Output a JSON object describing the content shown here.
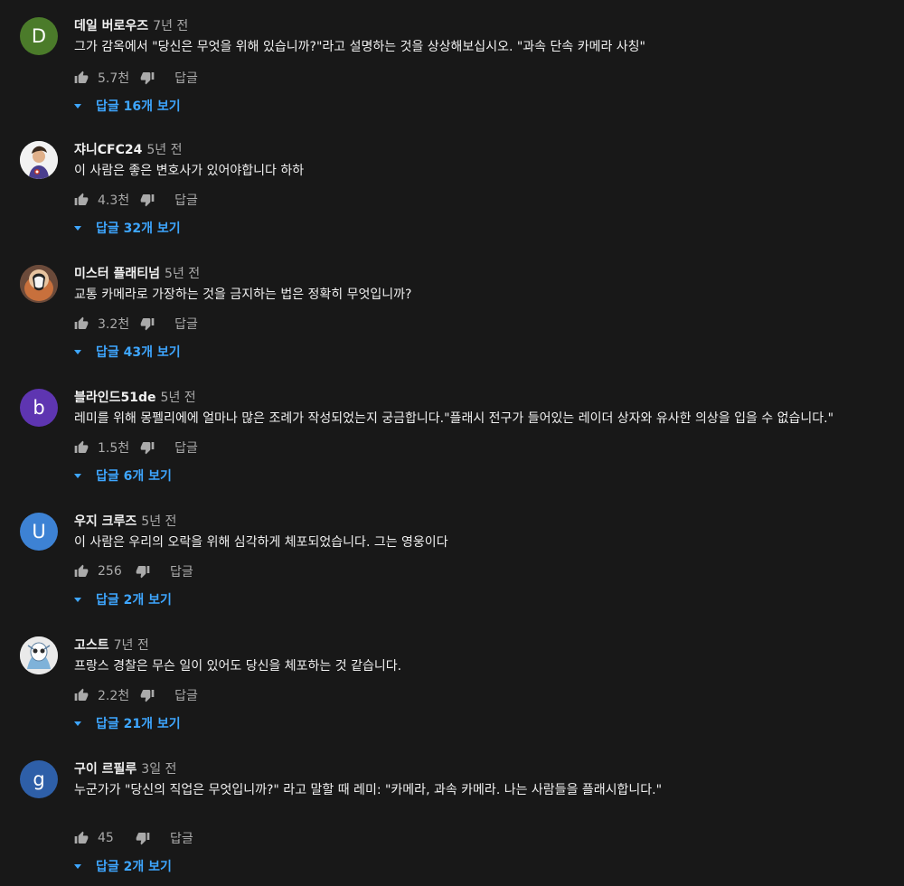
{
  "comments": [
    {
      "author": "데일 버로우즈",
      "time": "7년 전",
      "text": "그가 감옥에서 \"당신은 무엇을 위해 있습니까?\"라고 설명하는 것을 상상해보십시오. \"과속 단속 카메라 사칭\"",
      "likes": "5.7천",
      "reply_label": "답글",
      "replies_label": "답글 16개 보기",
      "avatar_letter": "D",
      "avatar_color": "#4b7b2a"
    },
    {
      "author": "쟈니CFC24",
      "time": "5년 전",
      "text": "이 사람은 좋은 변호사가 있어야합니다 하하",
      "likes": "4.3천",
      "reply_label": "답글",
      "replies_label": "답글 32개 보기",
      "avatar_letter": "",
      "avatar_color": "#f2f2f2"
    },
    {
      "author": "미스터 플래티넘",
      "time": "5년 전",
      "text": "교통 카메라로 가장하는 것을 금지하는 법은 정확히 무엇입니까?",
      "likes": "3.2천",
      "reply_label": "답글",
      "replies_label": "답글 43개 보기",
      "avatar_letter": "",
      "avatar_color": "#8a5a3c"
    },
    {
      "author": "블라인드51de",
      "time": "5년 전",
      "text": "레미를 위해 몽펠리에에 얼마나 많은 조례가 작성되었는지 궁금합니다.\"플래시 전구가 들어있는 레이더 상자와 유사한 의상을 입을 수 없습니다.\"",
      "likes": "1.5천",
      "reply_label": "답글",
      "replies_label": "답글 6개 보기",
      "avatar_letter": "b",
      "avatar_color": "#5e35b1"
    },
    {
      "author": "우지 크루즈",
      "time": "5년 전",
      "text": "이 사람은 우리의 오락을 위해 심각하게 체포되었습니다. 그는 영웅이다",
      "likes": "256",
      "reply_label": "답글",
      "replies_label": "답글 2개 보기",
      "avatar_letter": "U",
      "avatar_color": "#3d82d4"
    },
    {
      "author": "고스트",
      "time": "7년 전",
      "text": "프랑스 경찰은 무슨 일이 있어도 당신을 체포하는 것 같습니다.",
      "likes": "2.2천",
      "reply_label": "답글",
      "replies_label": "답글 21개 보기",
      "avatar_letter": "",
      "avatar_color": "#eaeaea"
    },
    {
      "author": "구이 르필루",
      "time": "3일 전",
      "text": "누군가가 \"당신의 직업은 무엇입니까?\" 라고 말할 때 레미: \"카메라, 과속 카메라. 나는 사람들을 플래시합니다.\"",
      "likes": "45",
      "reply_label": "답글",
      "replies_label": "답글 2개 보기",
      "avatar_letter": "g",
      "avatar_color": "#2e5fa8"
    }
  ]
}
